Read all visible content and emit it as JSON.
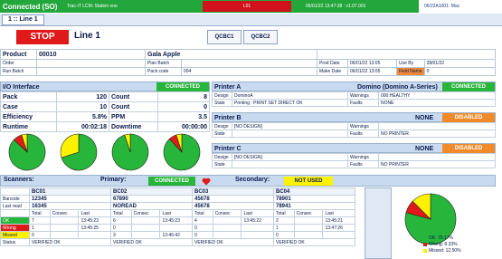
{
  "topbar": {
    "connection": "Connected (SO)",
    "station": "Trac-IT LCM: Station one",
    "alarm": "L01",
    "datetime_version": "06/01/22 13:47:38 : v1.07.001",
    "corner": "06/22A1001: Mac",
    "colors": {
      "bar": "#23a63b",
      "alarm": "#d1121a"
    }
  },
  "line_tab": "1 :: Line 1",
  "stop_label": "STOP",
  "line_name": "Line 1",
  "qc_buttons": [
    "QCBC1",
    "QCBC2"
  ],
  "product": {
    "product_label": "Product",
    "product_value": "00010",
    "product_name": "Gala Apple",
    "order_label": "Order",
    "plan_batch_label": "Plan Batch",
    "run_batch_label": "Run Batch",
    "pack_code_label": "Pack code",
    "pack_code_value": "004",
    "prod_date_label": "Prod Date",
    "prod_date_value": "06/01/22 13:05",
    "make_date_label": "Make Date",
    "make_date_value": "06/01/22 13:05",
    "use_by_label": "Use By",
    "use_by_value": "28/01/22",
    "field_label": "Field Name",
    "field_value": "0"
  },
  "io": {
    "title": "I/O Interface",
    "status": "CONNECTED",
    "rows": [
      {
        "label": "Pack",
        "value": "120",
        "label2": "Count",
        "value2": "8"
      },
      {
        "label": "Case",
        "value": "10",
        "label2": "Count",
        "value2": "0"
      },
      {
        "label": "Efficiency",
        "value": "5.8%",
        "label2": "PPM",
        "value2": "3.5"
      },
      {
        "label": "Runtime",
        "value": "00:02:18",
        "label2": "Downtime",
        "value2": "00:00:00"
      }
    ]
  },
  "small_pies": [
    {
      "name": "pie-1",
      "green": 0.87,
      "red": 0.08,
      "yellow": 0.05
    },
    {
      "name": "pie-2",
      "green": 0.7,
      "red": 0.0,
      "yellow": 0.3
    },
    {
      "name": "pie-3",
      "green": 0.95,
      "red": 0.0,
      "yellow": 0.05
    },
    {
      "name": "pie-4",
      "green": 0.88,
      "red": 0.07,
      "yellow": 0.05
    }
  ],
  "printer_a": {
    "title": "Printer A",
    "type": "Domino (Domino A-Series)",
    "status": "CONNECTED",
    "design_label": "Design",
    "design_value": "DominoA",
    "state_label": "State",
    "state_value": "Printing : PRINT SET DIRECT OK",
    "warnings_label": "Warnings",
    "warnings_value": "000:HEALTHY",
    "faults_label": "Faults",
    "faults_value": "NONE"
  },
  "printer_b": {
    "title": "Printer B",
    "type": "NONE",
    "status": "DISABLED",
    "design_label": "Design",
    "design_value": "[NO DESIGN]",
    "state_label": "State",
    "state_value": "",
    "warnings_label": "Warnings",
    "warnings_value": "",
    "faults_label": "Faults",
    "faults_value": "NO PRINTER"
  },
  "printer_c": {
    "title": "Printer C",
    "type": "NONE",
    "status": "DISABLED",
    "design_label": "Design",
    "design_value": "[NO DESIGN]",
    "state_label": "State",
    "state_value": "",
    "warnings_label": "Warnings",
    "warnings_value": "",
    "faults_label": "Faults",
    "faults_value": "NO PRINTER"
  },
  "scanners": {
    "label": "Scanners:",
    "primary_label": "Primary:",
    "primary_status": "CONNECTED",
    "secondary_label": "Secondary:",
    "secondary_status": "NOT USED"
  },
  "scan_rows": {
    "barcode": "Barcode",
    "last_read": "Last read",
    "total": "Total",
    "consec": "Consec",
    "last": "Last",
    "ok": "OK",
    "wrong": "Wrong",
    "missed": "Missed",
    "status": "Status"
  },
  "scan_units": [
    {
      "name": "BC01",
      "barcode": "12345",
      "last_read": "16345",
      "ok": [
        "7",
        "",
        "13:45:23"
      ],
      "wrong": [
        "1",
        "",
        "13:45:25"
      ],
      "missed": [
        "0",
        "",
        ""
      ],
      "status": "VERIFIED OK"
    },
    {
      "name": "BC02",
      "barcode": "67890",
      "last_read": "NOREAD",
      "ok": [
        "6",
        "",
        "13:45:23"
      ],
      "wrong": [
        "0",
        "",
        ""
      ],
      "missed": [
        "3",
        "",
        "13:45:42"
      ],
      "status": "VERIFIED OK"
    },
    {
      "name": "BC03",
      "barcode": "45678",
      "last_read": "45678",
      "ok": [
        "4",
        "",
        "13:45:22"
      ],
      "wrong": [
        "0",
        "",
        ""
      ],
      "missed": [
        "0",
        "",
        ""
      ],
      "status": "VERIFIED OK"
    },
    {
      "name": "BC04",
      "barcode": "78901",
      "last_read": "78941",
      "ok": [
        "2",
        "",
        "13:45:21"
      ],
      "wrong": [
        "1",
        "",
        "13:47:26"
      ],
      "missed": [
        "0",
        "",
        ""
      ],
      "status": "VERIFIED OK"
    }
  ],
  "summary_pie": {
    "ok": 0.7917,
    "wrong": 0.0833,
    "missed": 0.125
  },
  "legend": [
    "OK: 79.17%",
    "Wrong: 8.33%",
    "Missed: 12.50%"
  ],
  "colors": {
    "green": "#27b53b",
    "red": "#e01a1a",
    "yellow": "#fff200"
  }
}
